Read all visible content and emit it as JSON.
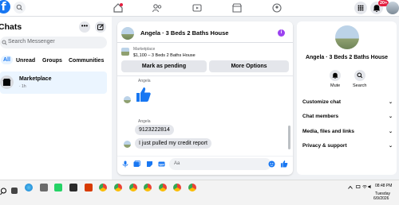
{
  "header": {
    "logo": "f",
    "notification_badge": "20+"
  },
  "sidebar": {
    "title": "Chats",
    "search_placeholder": "Search Messenger",
    "filters": [
      "All",
      "Unread",
      "Groups",
      "Communities"
    ],
    "conversation": {
      "name": "Marketplace",
      "time": "· 1h"
    }
  },
  "chat": {
    "title": "Angela · 3 Beds 2 Baths House",
    "marketplace_label": "Marketplace",
    "listing": "$1,100 – 3 Beds 2 Baths House",
    "pending_label": "Mark as pending",
    "options_label": "More Options",
    "messages": [
      {
        "sender": "Angela",
        "type": "like"
      },
      {
        "sender": "Angela",
        "text": "9123222814"
      },
      {
        "text": "I just pulled my credit report"
      }
    ],
    "input_placeholder": "Aa"
  },
  "right_panel": {
    "title": "Angela · 3 Beds 2 Baths House",
    "actions": [
      {
        "label": "Mute",
        "icon": "bell-icon"
      },
      {
        "label": "Search",
        "icon": "search-icon"
      }
    ],
    "menu": [
      "Customize chat",
      "Chat members",
      "Media, files and links",
      "Privacy & support"
    ]
  },
  "taskbar": {
    "time": "08:48 PM",
    "day": "Tuesday",
    "date": "6/9/2026"
  },
  "colors": {
    "brand": "#1877f2",
    "info": "#9b42f0",
    "badge": "#e41e3f"
  }
}
